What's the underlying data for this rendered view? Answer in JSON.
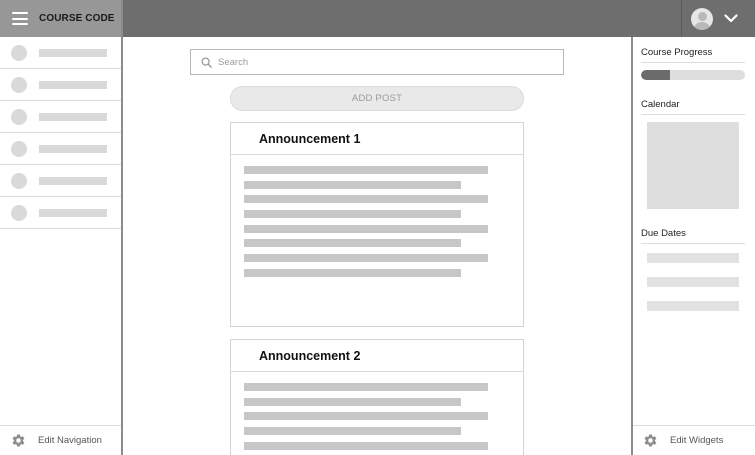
{
  "header": {
    "course_code": "COURSE CODE",
    "hamburger_icon": "menu-icon",
    "avatar_icon": "user-avatar-icon",
    "dropdown_icon": "chevron-down-icon"
  },
  "sidebar": {
    "items_count_placeholder": "",
    "footer_label": "Edit Navigation",
    "footer_icon": "gear-icon"
  },
  "main": {
    "search": {
      "placeholder": "Search",
      "icon": "search-icon"
    },
    "add_post_label": "ADD POST",
    "announcements": [
      {
        "title": "Announcement 1"
      },
      {
        "title": "Announcement 2"
      }
    ]
  },
  "widgets": {
    "course_progress": {
      "title": "Course Progress",
      "value": 0.28
    },
    "calendar": {
      "title": "Calendar"
    },
    "due_dates": {
      "title": "Due Dates"
    },
    "footer_label": "Edit Widgets",
    "footer_icon": "gear-icon"
  },
  "colors": {
    "topbar": "#6e6e6e",
    "brand_bg": "#979797",
    "placeholder_gray": "#d9d9d9",
    "progress_fill": "#6b6b6b"
  }
}
